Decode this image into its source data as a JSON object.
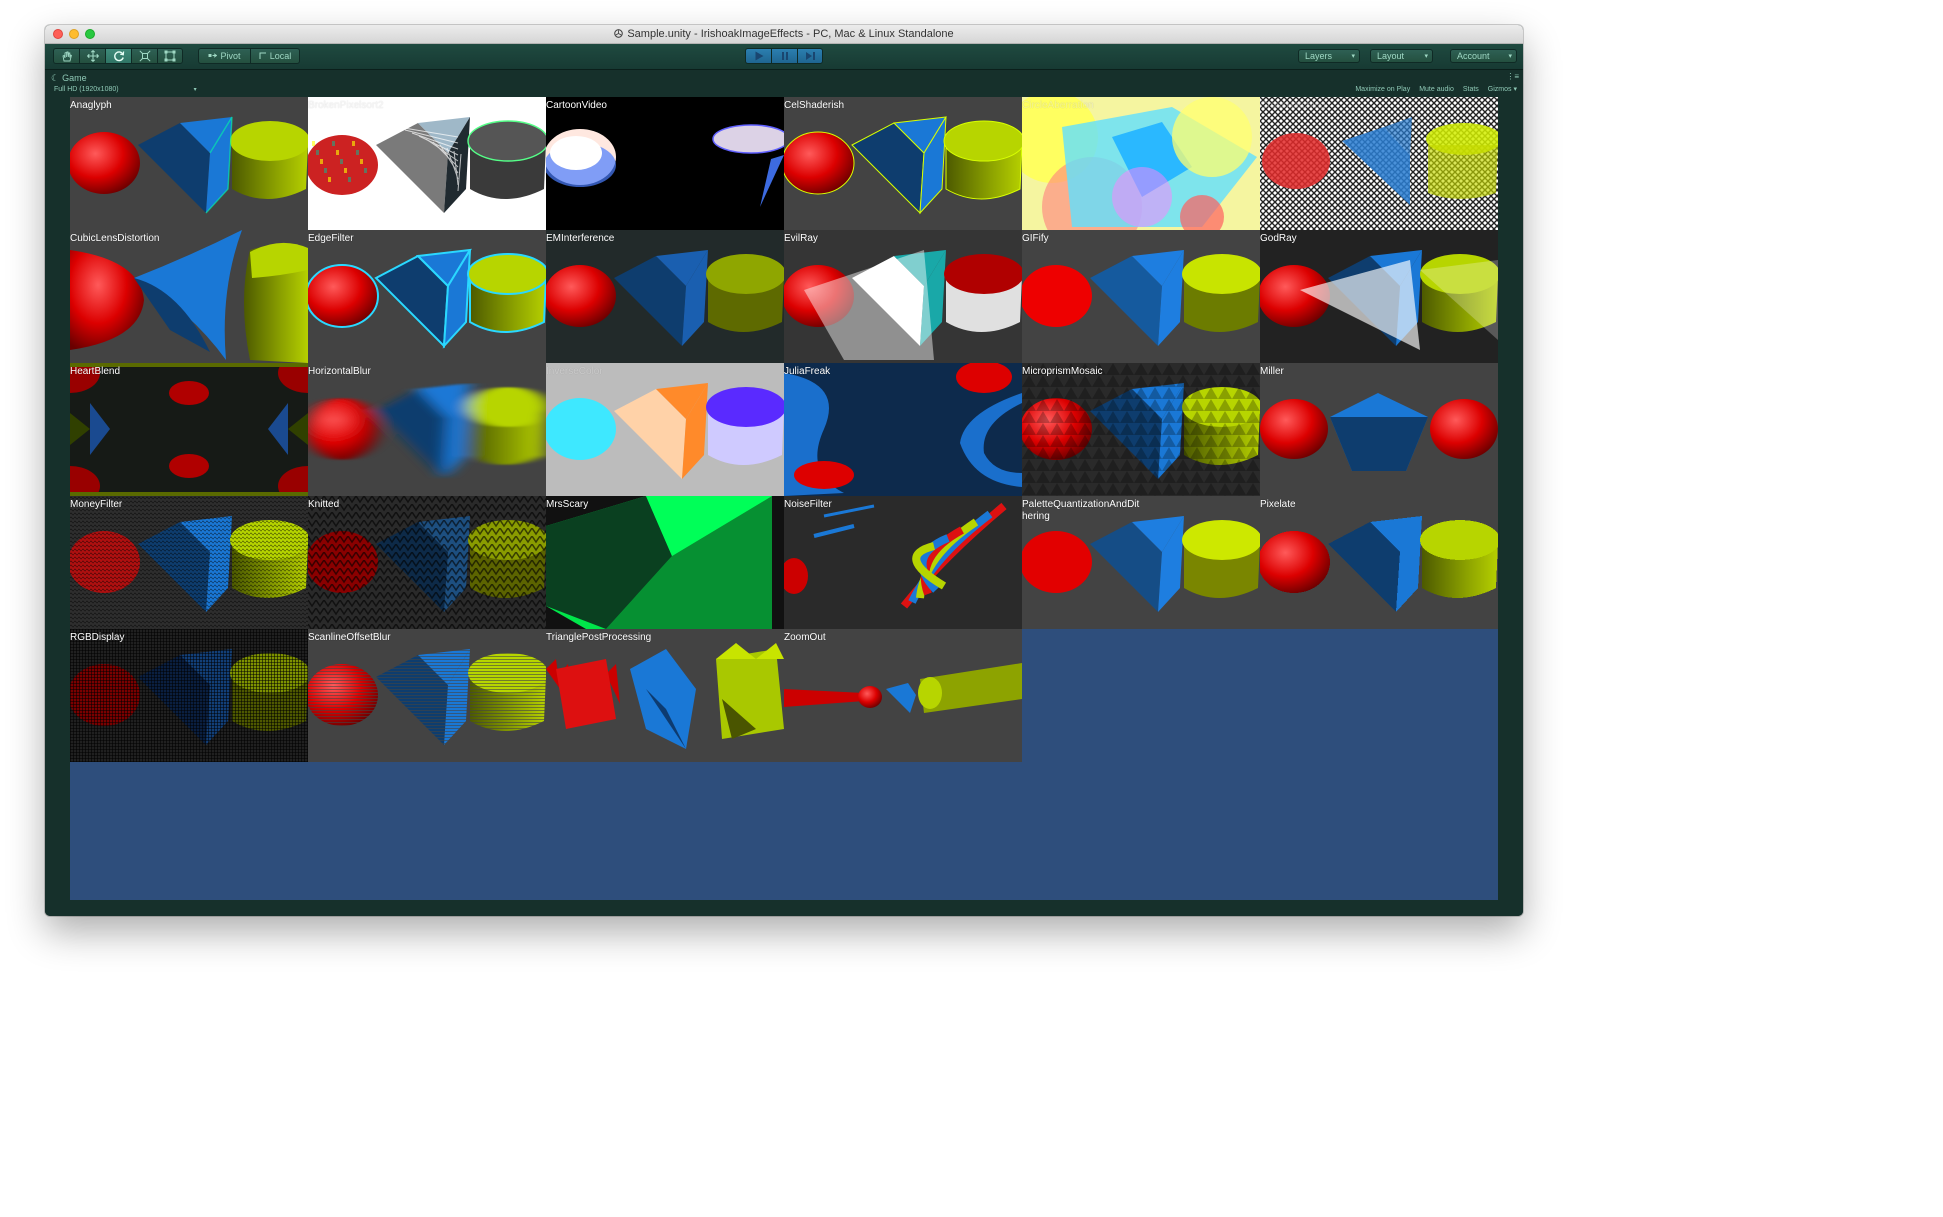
{
  "window": {
    "title": "Sample.unity - IrishoakImageEffects - PC, Mac & Linux Standalone"
  },
  "toolbar": {
    "tools": [
      {
        "icon": "hand-tool-icon"
      },
      {
        "icon": "move-tool-icon"
      },
      {
        "icon": "rotate-tool-icon"
      },
      {
        "icon": "scale-tool-icon"
      },
      {
        "icon": "rect-tool-icon"
      }
    ],
    "pivot_label": "Pivot",
    "local_label": "Local",
    "layers_label": "Layers",
    "layout_label": "Layout",
    "account_label": "Account"
  },
  "game_panel": {
    "tab_label": "Game",
    "resolution": "Full HD (1920x1080)",
    "maximize_label": "Maximize on Play",
    "mute_label": "Mute audio",
    "stats_label": "Stats",
    "gizmos_label": "Gizmos"
  },
  "colors": {
    "accent": "#2b7fb0",
    "panel_bg": "#16302b",
    "viewport_bg": "#2e4e7c",
    "tile_bg": "#434343"
  },
  "effects": [
    {
      "label": "Anaglyph",
      "style": "anaglyph"
    },
    {
      "label": "BrokenPixelsort2",
      "style": "pixelsort",
      "dim": true
    },
    {
      "label": "CartoonVideo",
      "style": "cartoon"
    },
    {
      "label": "CelShaderish",
      "style": "cel"
    },
    {
      "label": "CircleAberration",
      "style": "circle",
      "dim": true
    },
    {
      "label": "CrossHatching",
      "style": "cross",
      "dim": true
    },
    {
      "label": "CubicLensDistortion",
      "style": "lens"
    },
    {
      "label": "EdgeFilter",
      "style": "edge"
    },
    {
      "label": "EMInterference",
      "style": "em"
    },
    {
      "label": "EvilRay",
      "style": "evil"
    },
    {
      "label": "GIFify",
      "style": "gif"
    },
    {
      "label": "GodRay",
      "style": "god"
    },
    {
      "label": "HeartBlend",
      "style": "heart"
    },
    {
      "label": "HorizontalBlur",
      "style": "hblur"
    },
    {
      "label": "InverseColor",
      "style": "inverse",
      "dim": true
    },
    {
      "label": "JuliaFreak",
      "style": "julia"
    },
    {
      "label": "MicroprismMosaic",
      "style": "micro"
    },
    {
      "label": "Miller",
      "style": "miller"
    },
    {
      "label": "MoneyFilter",
      "style": "money"
    },
    {
      "label": "Knitted",
      "style": "knit"
    },
    {
      "label": "MrsScary",
      "style": "scary"
    },
    {
      "label": "NoiseFilter",
      "style": "noise"
    },
    {
      "label": "PaletteQuantizationAndDithering",
      "style": "palette"
    },
    {
      "label": "Pixelate",
      "style": "pixelate"
    },
    {
      "label": "RGBDisplay",
      "style": "rgb"
    },
    {
      "label": "ScanlineOffsetBlur",
      "style": "scanline"
    },
    {
      "label": "TrianglePostProcessing",
      "style": "triangle"
    },
    {
      "label": "ZoomOut",
      "style": "zoom"
    }
  ]
}
